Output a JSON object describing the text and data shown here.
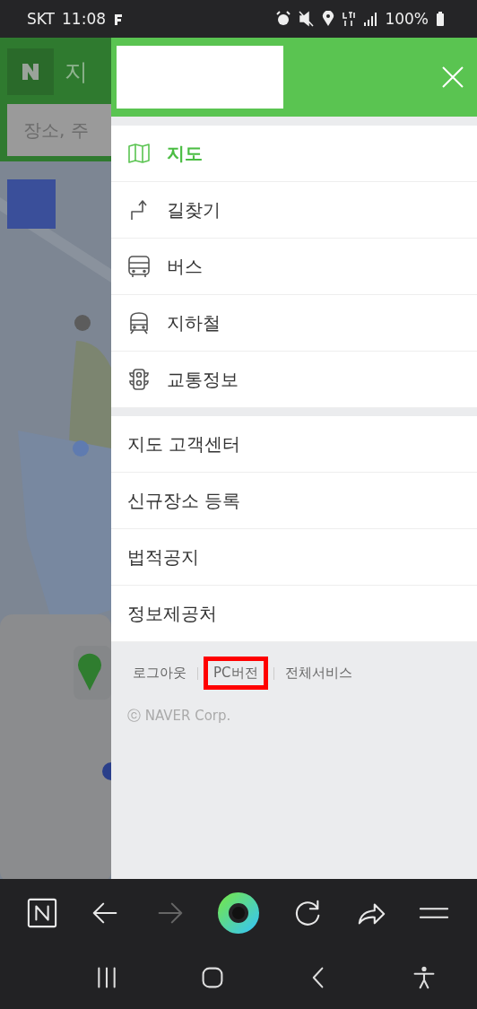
{
  "status_bar": {
    "carrier": "SKT",
    "time": "11:08",
    "battery": "100%"
  },
  "background_app": {
    "title": "지",
    "search": {
      "placeholder": "장소, 주"
    }
  },
  "menu": {
    "items": [
      {
        "label": "지도",
        "kind": "map",
        "selected": true
      },
      {
        "label": "길찾기",
        "kind": "route",
        "selected": false
      },
      {
        "label": "버스",
        "kind": "bus",
        "selected": false
      },
      {
        "label": "지하철",
        "kind": "subway",
        "selected": false
      },
      {
        "label": "교통정보",
        "kind": "traffic",
        "selected": false
      }
    ],
    "links": [
      {
        "label": "지도 고객센터"
      },
      {
        "label": "신규장소 등록"
      },
      {
        "label": "법적공지"
      },
      {
        "label": "정보제공처"
      }
    ],
    "footer_links": [
      {
        "label": "로그아웃",
        "highlighted": false
      },
      {
        "label": "PC버전",
        "highlighted": true
      },
      {
        "label": "전체서비스",
        "highlighted": false
      }
    ],
    "copyright": "ⓒ NAVER Corp."
  },
  "browser_toolbar": [
    {
      "kind": "home",
      "disabled": false
    },
    {
      "kind": "back",
      "disabled": false
    },
    {
      "kind": "forward",
      "disabled": true
    },
    {
      "kind": "ring",
      "disabled": false
    },
    {
      "kind": "reload",
      "disabled": false
    },
    {
      "kind": "share",
      "disabled": false
    },
    {
      "kind": "menu",
      "disabled": false
    }
  ],
  "nav_bar": [
    {
      "kind": "recents"
    },
    {
      "kind": "home"
    },
    {
      "kind": "back"
    },
    {
      "kind": "accessibility"
    }
  ]
}
